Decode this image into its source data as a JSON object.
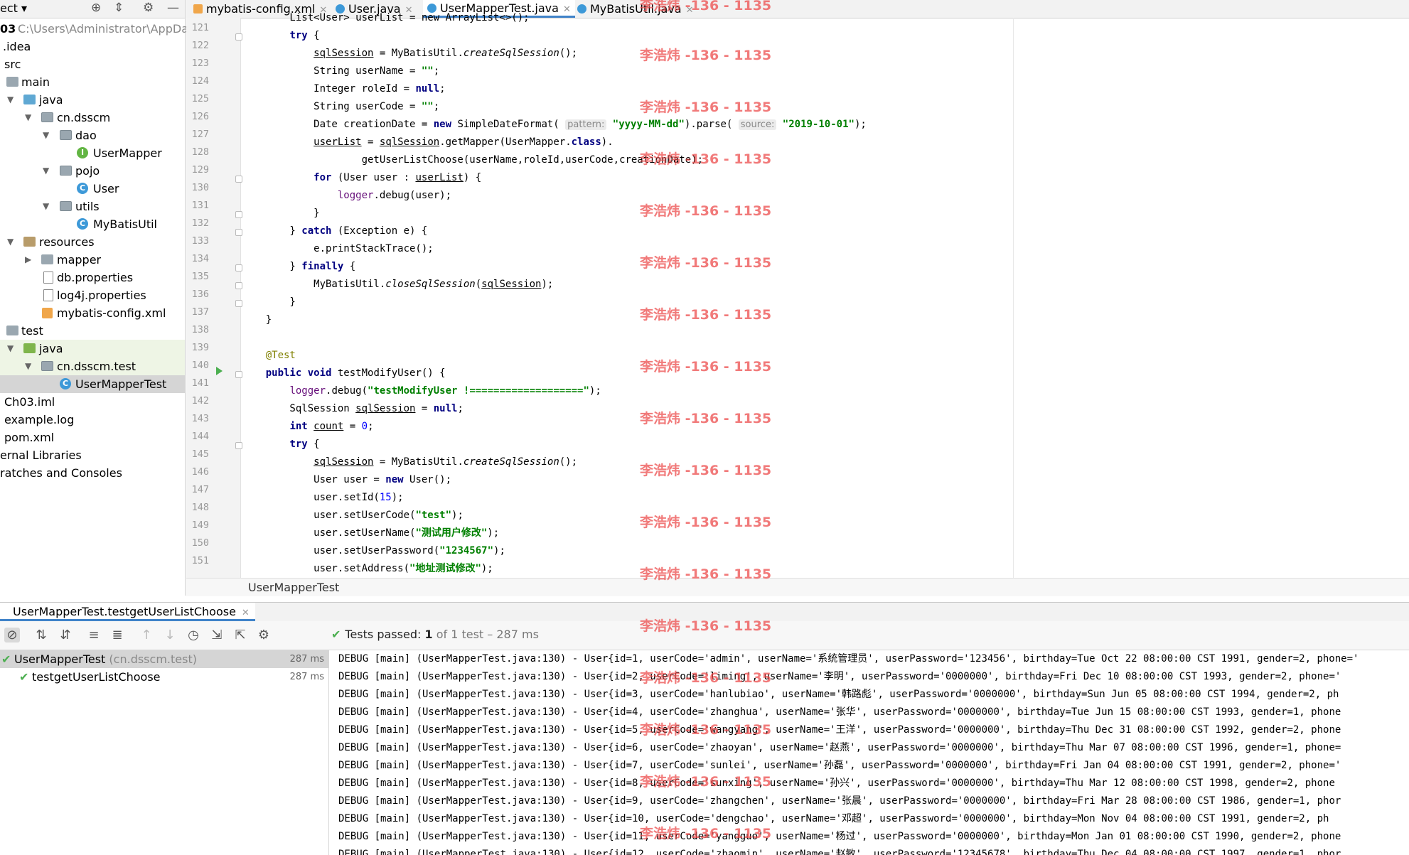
{
  "project_panel": {
    "title_fragment": "ect",
    "items": [
      {
        "label": "03",
        "path": "C:\\Users\\Administrator\\AppData"
      },
      {
        "label": ".idea"
      },
      {
        "label": "src"
      },
      {
        "label": "main"
      },
      {
        "label": "java"
      },
      {
        "label": "cn.dsscm"
      },
      {
        "label": "dao"
      },
      {
        "label": "UserMapper"
      },
      {
        "label": "pojo"
      },
      {
        "label": "User"
      },
      {
        "label": "utils"
      },
      {
        "label": "MyBatisUtil"
      },
      {
        "label": "resources"
      },
      {
        "label": "mapper"
      },
      {
        "label": "db.properties"
      },
      {
        "label": "log4j.properties"
      },
      {
        "label": "mybatis-config.xml"
      },
      {
        "label": "test"
      },
      {
        "label": "java"
      },
      {
        "label": "cn.dsscm.test"
      },
      {
        "label": "UserMapperTest"
      },
      {
        "label": "Ch03.iml"
      },
      {
        "label": "example.log"
      },
      {
        "label": "pom.xml"
      },
      {
        "label": "ernal Libraries"
      },
      {
        "label": "ratches and Consoles"
      }
    ]
  },
  "editor": {
    "tabs": [
      {
        "label": "mybatis-config.xml",
        "icon": "xml-file-icon"
      },
      {
        "label": "User.java",
        "icon": "class-icon"
      },
      {
        "label": "UserMapperTest.java",
        "icon": "class-icon",
        "active": true
      },
      {
        "label": "MyBatisUtil.java",
        "icon": "class-icon"
      }
    ],
    "line_numbers": [
      "121",
      "122",
      "123",
      "124",
      "125",
      "126",
      "127",
      "128",
      "129",
      "130",
      "131",
      "132",
      "133",
      "134",
      "135",
      "136",
      "137",
      "138",
      "139",
      "140",
      "141",
      "142",
      "143",
      "144",
      "145",
      "146",
      "147",
      "148",
      "149",
      "150",
      "151"
    ],
    "hints": {
      "pattern": "pattern:",
      "source": "source:"
    },
    "breadcrumb": "UserMapperTest"
  },
  "watermark": "李浩炜 -136 - 1135",
  "run_panel": {
    "tab_label": "UserMapperTest.testgetUserListChoose",
    "status_prefix": "Tests passed:",
    "status_count": "1",
    "status_detail": "of 1 test – 287 ms",
    "tree": [
      {
        "label": "UserMapperTest",
        "pkg": "(cn.dsscm.test)",
        "time": "287 ms"
      },
      {
        "label": "testgetUserListChoose",
        "time": "287 ms"
      }
    ],
    "console": [
      "DEBUG [main] (UserMapperTest.java:130) - User{id=1, userCode='admin', userName='系统管理员', userPassword='123456', birthday=Tue Oct 22 08:00:00 CST 1991, gender=2, phone='",
      "DEBUG [main] (UserMapperTest.java:130) - User{id=2, userCode='liming', userName='李明', userPassword='0000000', birthday=Fri Dec 10 08:00:00 CST 1993, gender=2, phone='",
      "DEBUG [main] (UserMapperTest.java:130) - User{id=3, userCode='hanlubiao', userName='韩路彪', userPassword='0000000', birthday=Sun Jun 05 08:00:00 CST 1994, gender=2, ph",
      "DEBUG [main] (UserMapperTest.java:130) - User{id=4, userCode='zhanghua', userName='张华', userPassword='0000000', birthday=Tue Jun 15 08:00:00 CST 1993, gender=1, phone",
      "DEBUG [main] (UserMapperTest.java:130) - User{id=5, userCode='wangyang', userName='王洋', userPassword='0000000', birthday=Thu Dec 31 08:00:00 CST 1992, gender=2, phone",
      "DEBUG [main] (UserMapperTest.java:130) - User{id=6, userCode='zhaoyan', userName='赵燕', userPassword='0000000', birthday=Thu Mar 07 08:00:00 CST 1996, gender=1, phone=",
      "DEBUG [main] (UserMapperTest.java:130) - User{id=7, userCode='sunlei', userName='孙磊', userPassword='0000000', birthday=Fri Jan 04 08:00:00 CST 1991, gender=2, phone='",
      "DEBUG [main] (UserMapperTest.java:130) - User{id=8, userCode='sunxing', userName='孙兴', userPassword='0000000', birthday=Thu Mar 12 08:00:00 CST 1998, gender=2, phone",
      "DEBUG [main] (UserMapperTest.java:130) - User{id=9, userCode='zhangchen', userName='张晨', userPassword='0000000', birthday=Fri Mar 28 08:00:00 CST 1986, gender=1, phor",
      "DEBUG [main] (UserMapperTest.java:130) - User{id=10, userCode='dengchao', userName='邓超', userPassword='0000000', birthday=Mon Nov 04 08:00:00 CST 1991, gender=2, ph",
      "DEBUG [main] (UserMapperTest.java:130) - User{id=11, userCode='yangguo', userName='杨过', userPassword='0000000', birthday=Mon Jan 01 08:00:00 CST 1990, gender=2, phone",
      "DEBUG [main] (UserMapperTest.java:130) - User{id=12, userCode='zhaomin', userName='赵敏', userPassword='12345678', birthday=Thu Dec 04 08:00:00 CST 1997, gender=1, phor"
    ]
  }
}
